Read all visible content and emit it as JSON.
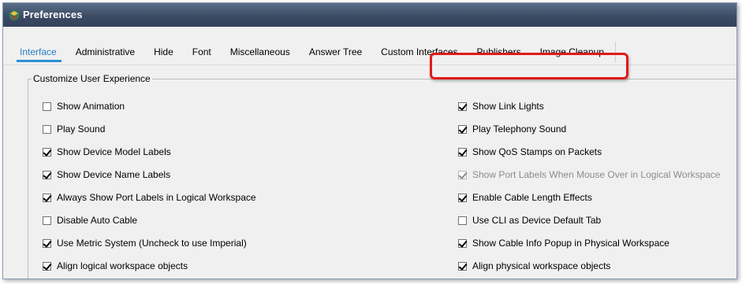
{
  "window": {
    "title": "Preferences"
  },
  "tabs": [
    {
      "label": "Interface",
      "active": true
    },
    {
      "label": "Administrative",
      "active": false
    },
    {
      "label": "Hide",
      "active": false
    },
    {
      "label": "Font",
      "active": false
    },
    {
      "label": "Miscellaneous",
      "active": false
    },
    {
      "label": "Answer Tree",
      "active": false
    },
    {
      "label": "Custom Interfaces",
      "active": false
    },
    {
      "label": "Publishers",
      "active": false
    },
    {
      "label": "Image Cleanup",
      "active": false
    }
  ],
  "group": {
    "title": "Customize User Experience"
  },
  "options_left": [
    {
      "label": "Show Animation",
      "checked": false
    },
    {
      "label": "Play Sound",
      "checked": false
    },
    {
      "label": "Show Device Model Labels",
      "checked": true
    },
    {
      "label": "Show Device Name Labels",
      "checked": true
    },
    {
      "label": "Always Show Port Labels in Logical Workspace",
      "checked": true
    },
    {
      "label": "Disable Auto Cable",
      "checked": false
    },
    {
      "label": "Use Metric System (Uncheck to use Imperial)",
      "checked": true
    },
    {
      "label": "Align logical workspace objects",
      "checked": true
    }
  ],
  "options_right": [
    {
      "label": "Show Link Lights",
      "checked": true,
      "enabled": true
    },
    {
      "label": "Play Telephony Sound",
      "checked": true,
      "enabled": true,
      "highlighted": true
    },
    {
      "label": "Show QoS Stamps on Packets",
      "checked": true,
      "enabled": true
    },
    {
      "label": "Show Port Labels When Mouse Over in Logical Workspace",
      "checked": true,
      "enabled": false
    },
    {
      "label": "Enable Cable Length Effects",
      "checked": true,
      "enabled": true
    },
    {
      "label": "Use CLI as Device Default Tab",
      "checked": false,
      "enabled": true
    },
    {
      "label": "Show Cable Info Popup in Physical Workspace",
      "checked": true,
      "enabled": true
    },
    {
      "label": "Align physical workspace objects",
      "checked": true,
      "enabled": true
    }
  ],
  "colors": {
    "titlebar": "#3b4b63",
    "active_tab": "#2a7ec4",
    "highlight_border": "#e01b1b"
  }
}
